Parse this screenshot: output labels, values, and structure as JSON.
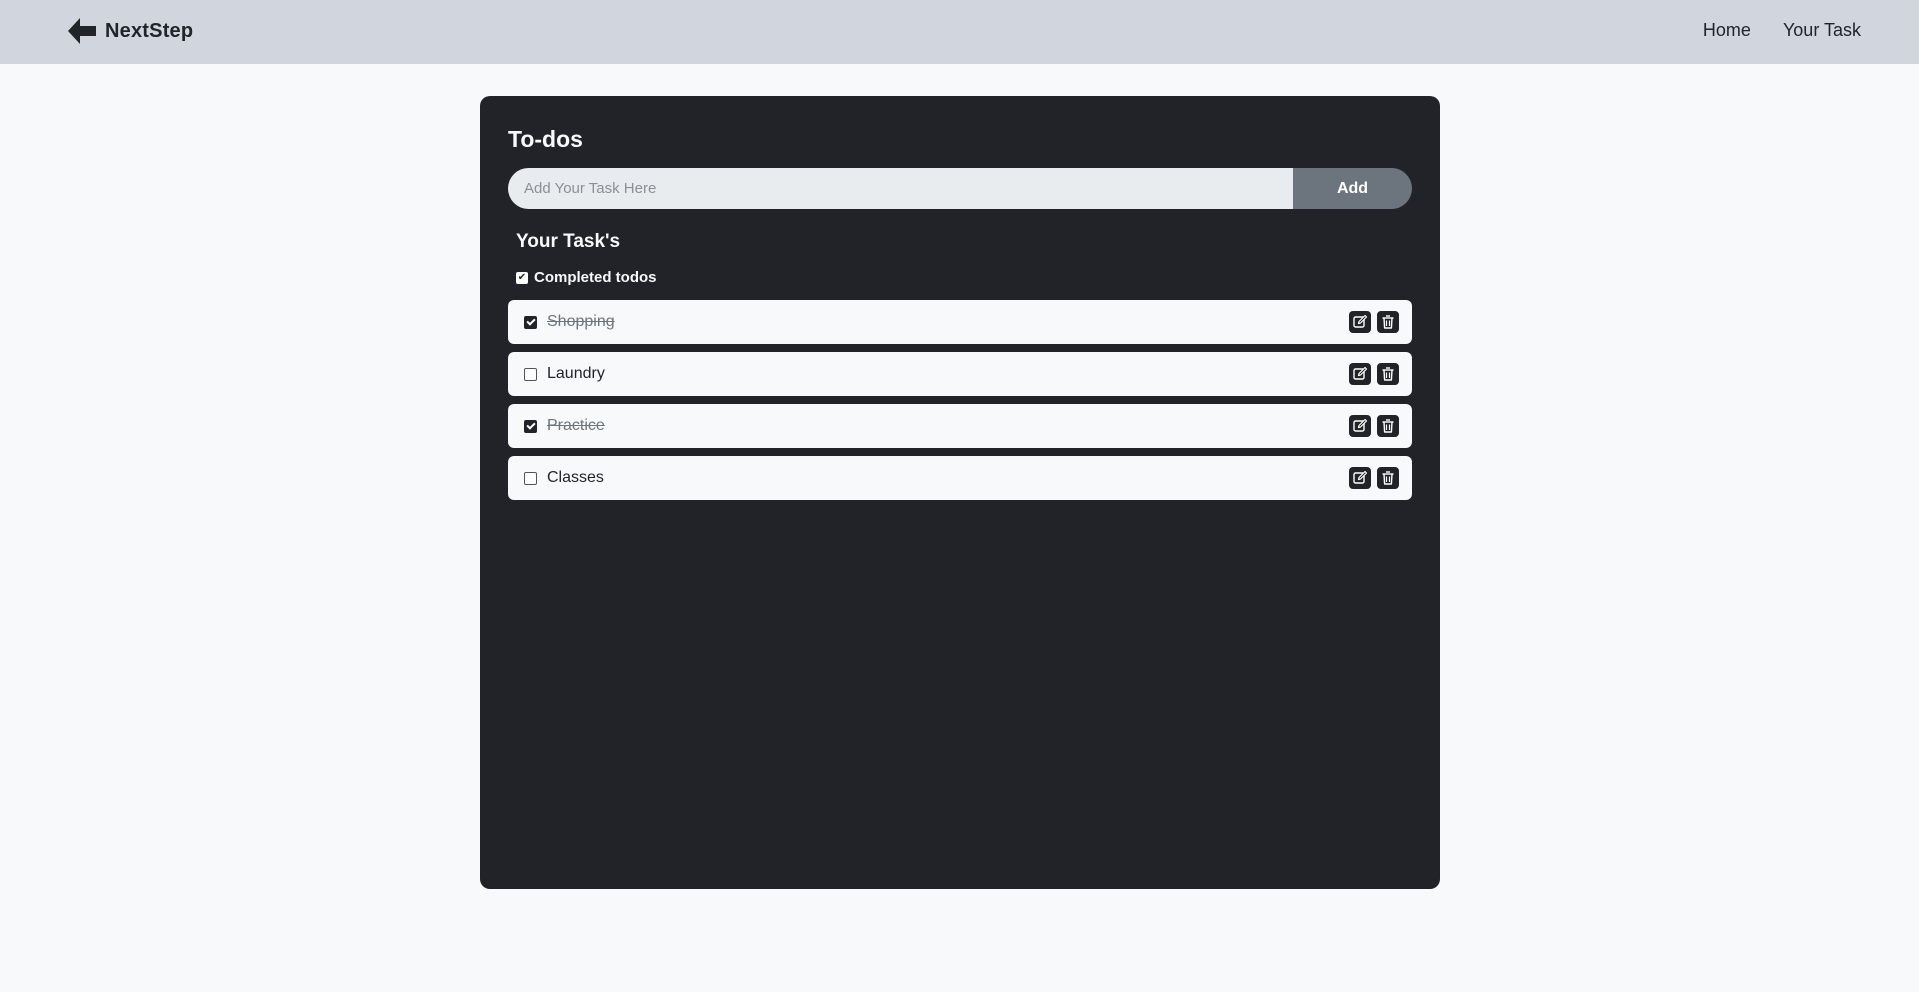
{
  "navbar": {
    "brand_name": "NextStep",
    "brand_icon": "arrow-left-icon",
    "links": [
      {
        "label": "Home"
      },
      {
        "label": "Your Task"
      }
    ]
  },
  "card": {
    "title": "To-dos",
    "input": {
      "placeholder": "Add Your Task Here",
      "value": ""
    },
    "add_label": "Add",
    "section_title": "Your Task's",
    "completed_toggle": {
      "label": "Completed todos",
      "checked": true
    },
    "todos": [
      {
        "text": "Shopping",
        "completed": true
      },
      {
        "text": "Laundry",
        "completed": false
      },
      {
        "text": "Practice",
        "completed": true
      },
      {
        "text": "Classes",
        "completed": false
      }
    ],
    "actions": {
      "edit_icon": "edit-icon",
      "delete_icon": "trash-icon"
    }
  },
  "colors": {
    "navbar_bg": "#d1d5dd",
    "page_bg": "#f8f9fb",
    "card_bg": "#212328",
    "add_button_bg": "#6c757d",
    "input_bg": "#e8ecef"
  }
}
